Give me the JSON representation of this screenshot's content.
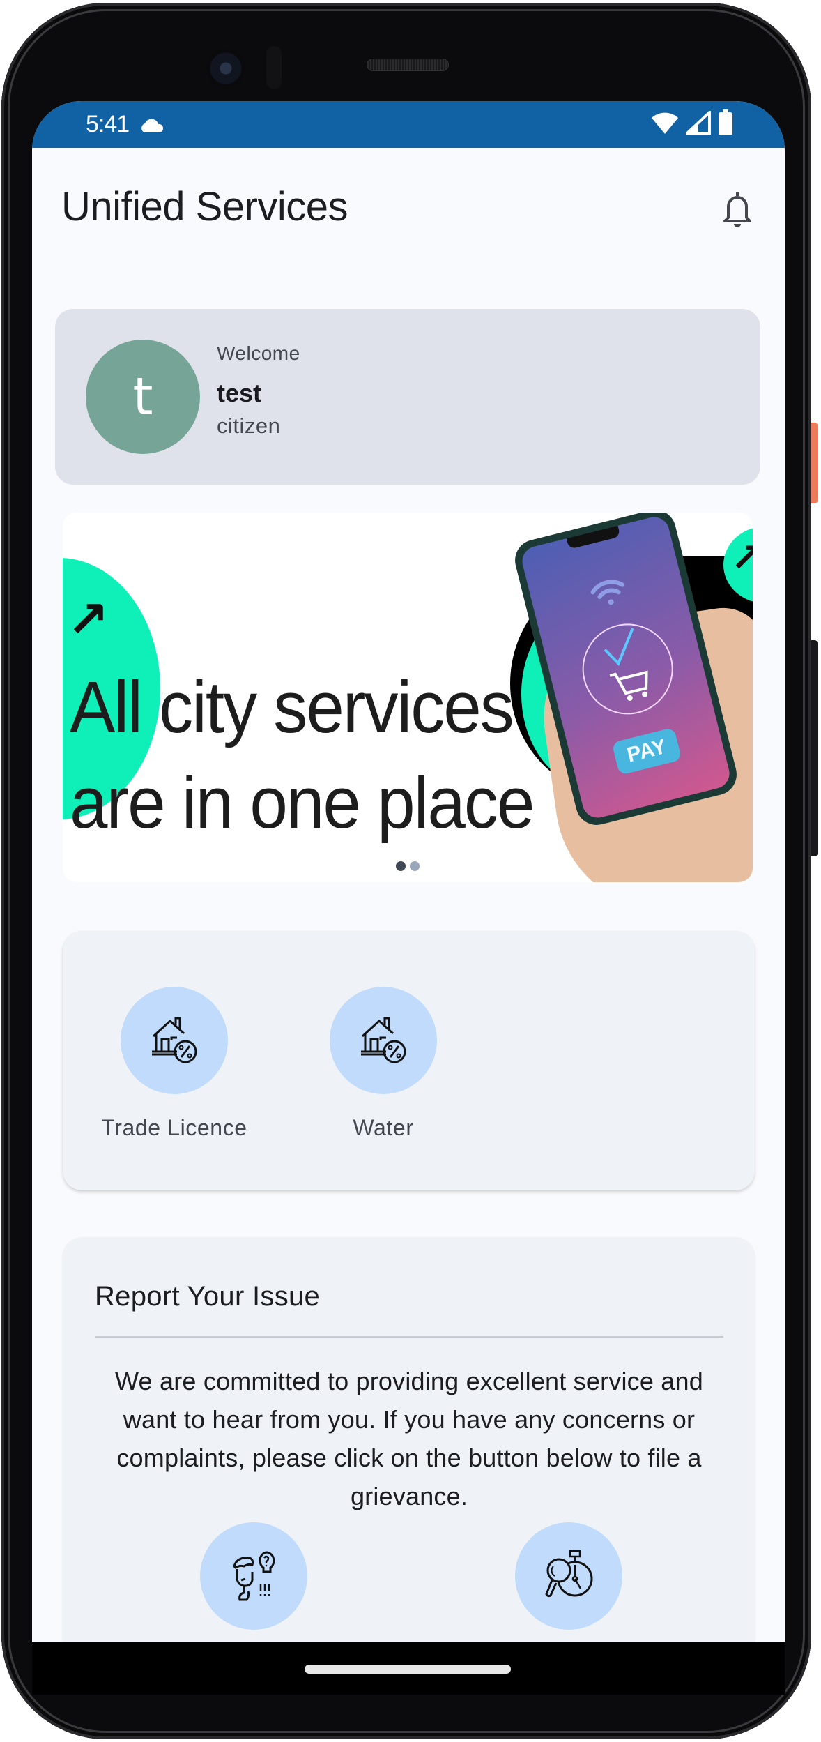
{
  "status_bar": {
    "time": "5:41",
    "icons": [
      "cloud-icon",
      "wifi-icon",
      "cellular-signal-icon",
      "battery-icon"
    ]
  },
  "header": {
    "title": "Unified Services",
    "notification_icon": "bell-icon"
  },
  "welcome_card": {
    "greeting": "Welcome",
    "avatar_initial": "t",
    "user_name": "test",
    "user_role": "citizen"
  },
  "banner": {
    "headline_line1": "All city services",
    "headline_line2": "are in one place",
    "pay_label": "PAY",
    "slide_count": 2,
    "active_slide": 1
  },
  "services": {
    "items": [
      {
        "label": "Trade Licence",
        "icon": "house-percent-icon"
      },
      {
        "label": "Water",
        "icon": "house-percent-icon"
      }
    ]
  },
  "report_issue": {
    "title": "Report Your Issue",
    "description": "We are committed to providing excellent service and want to hear from you. If you have any concerns or complaints, please click on the button below to file a grievance.",
    "actions": [
      {
        "icon": "thinking-person-question-icon"
      },
      {
        "icon": "magnifier-stopwatch-icon"
      }
    ]
  },
  "colors": {
    "status_bar": "#1162a5",
    "avatar": "#76a598",
    "welcome_card": "#dfe2ea",
    "card_bg": "#eff2f7",
    "icon_circle": "#c0dbfb",
    "banner_accent": "#0ff0b8"
  }
}
